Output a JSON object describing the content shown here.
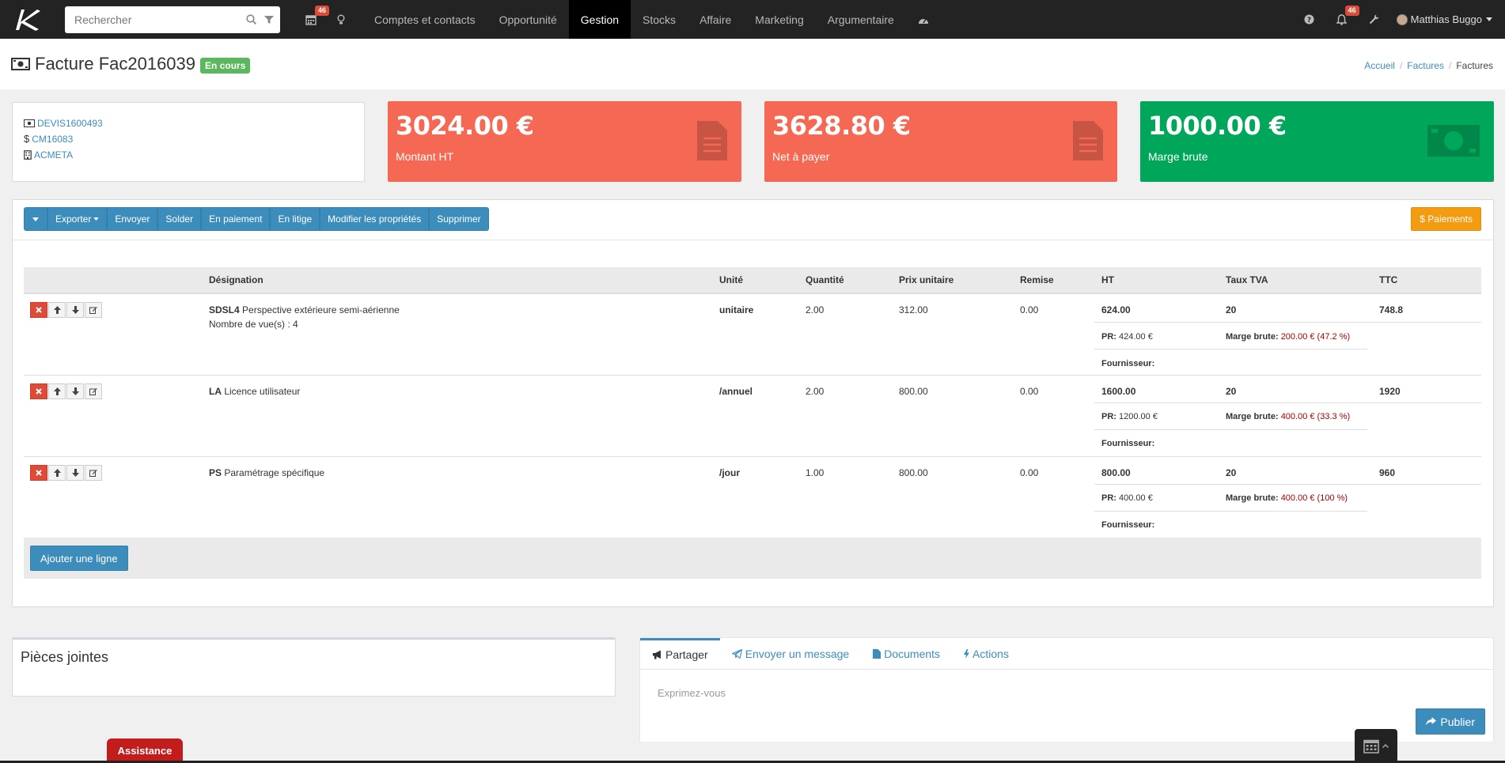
{
  "nav": {
    "search_placeholder": "Rechercher",
    "calendar_badge": "46",
    "notif_badge": "46",
    "menu": [
      "Comptes et contacts",
      "Opportunité",
      "Gestion",
      "Stocks",
      "Affaire",
      "Marketing",
      "Argumentaire"
    ],
    "active_menu": "Gestion",
    "user": "Matthias Buggo"
  },
  "page": {
    "title": "Facture Fac2016039",
    "status": "En cours",
    "breadcrumb": [
      "Accueil",
      "Factures",
      "Factures"
    ]
  },
  "links": {
    "devis": "DEVIS1600493",
    "commande": "CM16083",
    "societe": "ACMETA"
  },
  "kpis": [
    {
      "value": "3024.00 €",
      "label": "Montant HT",
      "color": "#f56954"
    },
    {
      "value": "3628.80 €",
      "label": "Net à payer",
      "color": "#f56954"
    },
    {
      "value": "1000.00 €",
      "label": "Marge brute",
      "color": "#00a65a"
    }
  ],
  "toolbar": {
    "buttons": [
      "Exporter",
      "Envoyer",
      "Solder",
      "En paiement",
      "En litige",
      "Modifier les propriétés",
      "Supprimer"
    ],
    "payments": "$ Paiements"
  },
  "table": {
    "headers": [
      "Désignation",
      "Unité",
      "Quantité",
      "Prix unitaire",
      "Remise",
      "HT",
      "Taux TVA",
      "TTC"
    ],
    "rows": [
      {
        "code": "SDSL4",
        "name": "Perspective extérieure semi-aérienne",
        "extra": "Nombre de vue(s) :  4",
        "unit": "unitaire",
        "qty": "2.00",
        "pu": "312.00",
        "remise": "0.00",
        "ht": "624.00",
        "tva": "20",
        "ttc": "748.8",
        "pr_label": "PR:",
        "pr": "424.00 €",
        "marge_label": "Marge brute:",
        "marge": "200.00 € (47.2 %)",
        "fourn": "Fournisseur:"
      },
      {
        "code": "LA",
        "name": "Licence utilisateur",
        "extra": "",
        "unit": "/annuel",
        "qty": "2.00",
        "pu": "800.00",
        "remise": "0.00",
        "ht": "1600.00",
        "tva": "20",
        "ttc": "1920",
        "pr_label": "PR:",
        "pr": "1200.00 €",
        "marge_label": "Marge brute:",
        "marge": "400.00 € (33.3 %)",
        "fourn": "Fournisseur:"
      },
      {
        "code": "PS",
        "name": "Paramétrage spécifique",
        "extra": "",
        "unit": "/jour",
        "qty": "1.00",
        "pu": "800.00",
        "remise": "0.00",
        "ht": "800.00",
        "tva": "20",
        "ttc": "960",
        "pr_label": "PR:",
        "pr": "400.00 €",
        "marge_label": "Marge brute:",
        "marge": "400.00 € (100 %)",
        "fourn": "Fournisseur:"
      }
    ],
    "add_line": "Ajouter une ligne"
  },
  "attachments": {
    "title": "Pièces jointes"
  },
  "social": {
    "tabs": [
      "Partager",
      "Envoyer un message",
      "Documents",
      "Actions"
    ],
    "placeholder": "Exprimez-vous",
    "publish": "Publier"
  },
  "assist": "Assistance"
}
